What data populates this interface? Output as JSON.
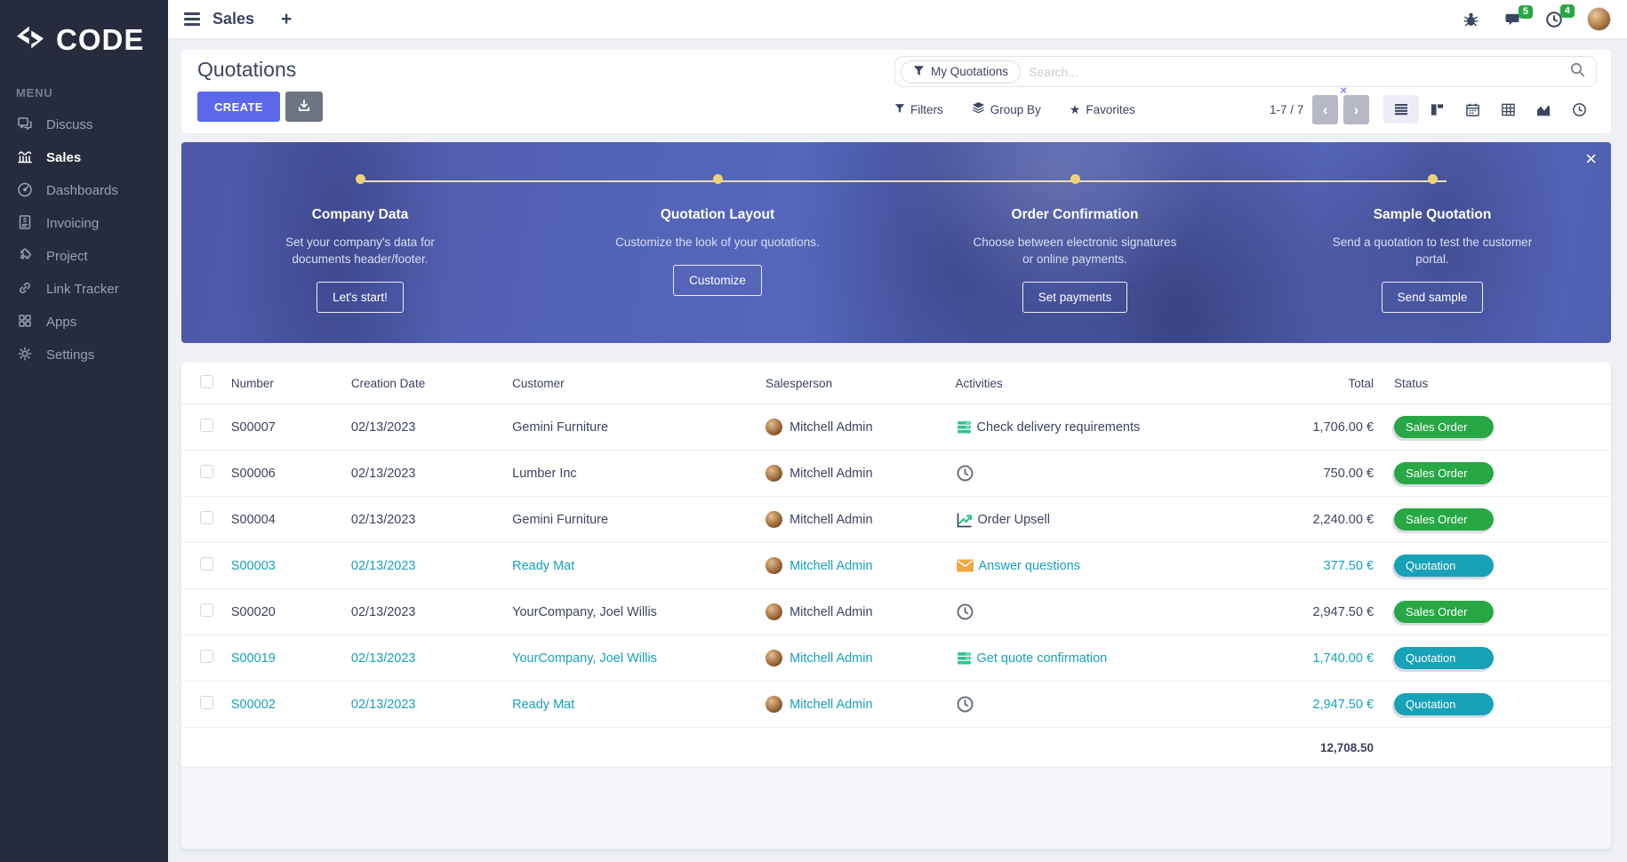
{
  "colors": {
    "accent": "#5b68ea",
    "teal": "#17a2b8",
    "green": "#28a745",
    "sidebar_bg": "#262c3e",
    "dark_text": "#3a4560",
    "banner_dot": "#eed27a"
  },
  "sidebar": {
    "logo_text": "CODE",
    "menu_label": "MENU",
    "items": [
      {
        "label": "Discuss"
      },
      {
        "label": "Sales"
      },
      {
        "label": "Dashboards"
      },
      {
        "label": "Invoicing"
      },
      {
        "label": "Project"
      },
      {
        "label": "Link Tracker"
      },
      {
        "label": "Apps"
      },
      {
        "label": "Settings"
      }
    ]
  },
  "topbar": {
    "title": "Sales",
    "new_tab_label": "+",
    "messages_count": "5",
    "activities_count": "4"
  },
  "control_panel": {
    "title": "Quotations",
    "create_label": "CREATE",
    "facet_label": "My Quotations",
    "facet_remove": "×",
    "search_placeholder": "Search...",
    "filters_label": "Filters",
    "group_by_label": "Group By",
    "favorites_label": "Favorites",
    "pager": "1-7 / 7",
    "prev_label": "‹",
    "next_label": "›"
  },
  "onboarding": {
    "close": "×",
    "steps": [
      {
        "title": "Company Data",
        "description": "Set your company's data for documents header/footer.",
        "button": "Let's start!"
      },
      {
        "title": "Quotation Layout",
        "description": "Customize the look of your quotations.",
        "button": "Customize"
      },
      {
        "title": "Order Confirmation",
        "description": "Choose between electronic signatures or online payments.",
        "button": "Set payments"
      },
      {
        "title": "Sample Quotation",
        "description": "Send a quotation to test the customer portal.",
        "button": "Send sample"
      }
    ]
  },
  "table": {
    "headers": {
      "number": "Number",
      "creation_date": "Creation Date",
      "customer": "Customer",
      "salesperson": "Salesperson",
      "activities": "Activities",
      "total": "Total",
      "status": "Status"
    },
    "rows": [
      {
        "number": "S00007",
        "creation_date": "02/13/2023",
        "customer": "Gemini Furniture",
        "salesperson": "Mitchell Admin",
        "activity": "Check delivery requirements",
        "activity_icon": "tasks-icon",
        "total": "1,706.00 €",
        "status": "Sales Order"
      },
      {
        "number": "S00006",
        "creation_date": "02/13/2023",
        "customer": "Lumber Inc",
        "salesperson": "Mitchell Admin",
        "activity": "",
        "activity_icon": "clock-icon",
        "total": "750.00 €",
        "status": "Sales Order"
      },
      {
        "number": "S00004",
        "creation_date": "02/13/2023",
        "customer": "Gemini Furniture",
        "salesperson": "Mitchell Admin",
        "activity": "Order Upsell",
        "activity_icon": "chart-icon",
        "total": "2,240.00 €",
        "status": "Sales Order"
      },
      {
        "number": "S00003",
        "creation_date": "02/13/2023",
        "customer": "Ready Mat",
        "salesperson": "Mitchell Admin",
        "activity": "Answer questions",
        "activity_icon": "email-icon",
        "total": "377.50 €",
        "status": "Quotation"
      },
      {
        "number": "S00020",
        "creation_date": "02/13/2023",
        "customer": "YourCompany, Joel Willis",
        "salesperson": "Mitchell Admin",
        "activity": "",
        "activity_icon": "clock-icon",
        "total": "2,947.50 €",
        "status": "Sales Order"
      },
      {
        "number": "S00019",
        "creation_date": "02/13/2023",
        "customer": "YourCompany, Joel Willis",
        "salesperson": "Mitchell Admin",
        "activity": "Get quote confirmation",
        "activity_icon": "tasks-icon",
        "total": "1,740.00 €",
        "status": "Quotation"
      },
      {
        "number": "S00002",
        "creation_date": "02/13/2023",
        "customer": "Ready Mat",
        "salesperson": "Mitchell Admin",
        "activity": "",
        "activity_icon": "clock-icon",
        "total": "2,947.50 €",
        "status": "Quotation"
      }
    ],
    "footer_total": "12,708.50"
  }
}
